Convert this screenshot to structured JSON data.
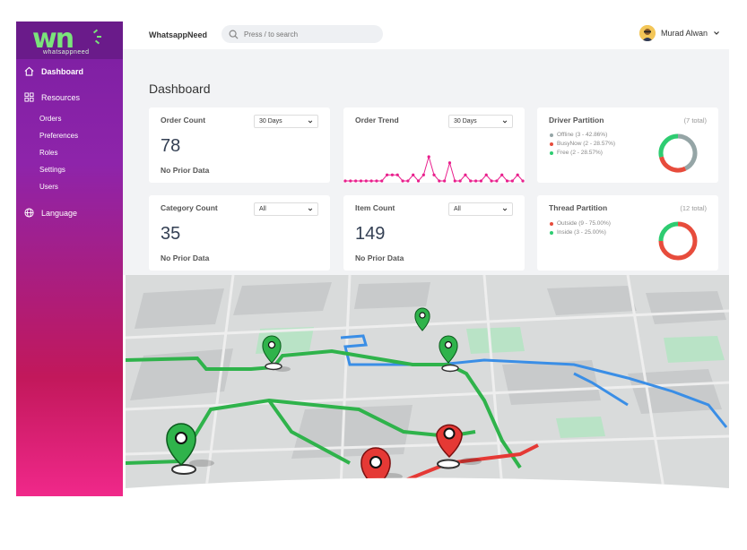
{
  "brand": {
    "logo": "wn",
    "sub": "whatsappneed",
    "app_title": "WhatsappNeed",
    "green": "#7be37b"
  },
  "search": {
    "placeholder": "Press / to search"
  },
  "user": {
    "name": "Murad Alwan"
  },
  "sidebar": {
    "items": [
      {
        "label": "Dashboard",
        "icon": "home-icon"
      },
      {
        "label": "Resources",
        "icon": "grid-icon"
      },
      {
        "label": "Language",
        "icon": "globe-icon"
      }
    ],
    "sub_items": [
      "Orders",
      "Preferences",
      "Roles",
      "Settings",
      "Users"
    ]
  },
  "page": {
    "title": "Dashboard"
  },
  "cards": {
    "order_count": {
      "title": "Order Count",
      "period": "30 Days",
      "value": "78",
      "sub": "No Prior Data"
    },
    "order_trend": {
      "title": "Order Trend",
      "period": "30 Days"
    },
    "driver_partition": {
      "title": "Driver Partition",
      "total": "(7 total)",
      "legend": [
        {
          "label": "Offline (3 - 42.86%)",
          "color": "#95a5a6",
          "value": 42.86
        },
        {
          "label": "BusyNow (2 - 28.57%)",
          "color": "#e74c3c",
          "value": 28.57
        },
        {
          "label": "Free (2 - 28.57%)",
          "color": "#2ecc71",
          "value": 28.57
        }
      ]
    },
    "category_count": {
      "title": "Category Count",
      "filter": "All",
      "value": "35",
      "sub": "No Prior Data"
    },
    "item_count": {
      "title": "Item Count",
      "filter": "All",
      "value": "149",
      "sub": "No Prior Data"
    },
    "thread_partition": {
      "title": "Thread Partition",
      "total": "(12 total)",
      "legend": [
        {
          "label": "Outside (9 - 75.00%)",
          "color": "#e74c3c",
          "value": 75.0
        },
        {
          "label": "Inside (3 - 25.00%)",
          "color": "#2ecc71",
          "value": 25.0
        }
      ]
    }
  },
  "trend": {
    "values": [
      0,
      0,
      0,
      0,
      0,
      0,
      0,
      0,
      1,
      1,
      1,
      0,
      0,
      1,
      0,
      1,
      4,
      1,
      0,
      0,
      3,
      0,
      0,
      1,
      0,
      0,
      0,
      1,
      0,
      0,
      1,
      0,
      0,
      1,
      0
    ]
  },
  "colors": {
    "accent": "#e91e8c",
    "sidebar_top": "#7b1fa2",
    "sidebar_bottom": "#f0288a"
  }
}
